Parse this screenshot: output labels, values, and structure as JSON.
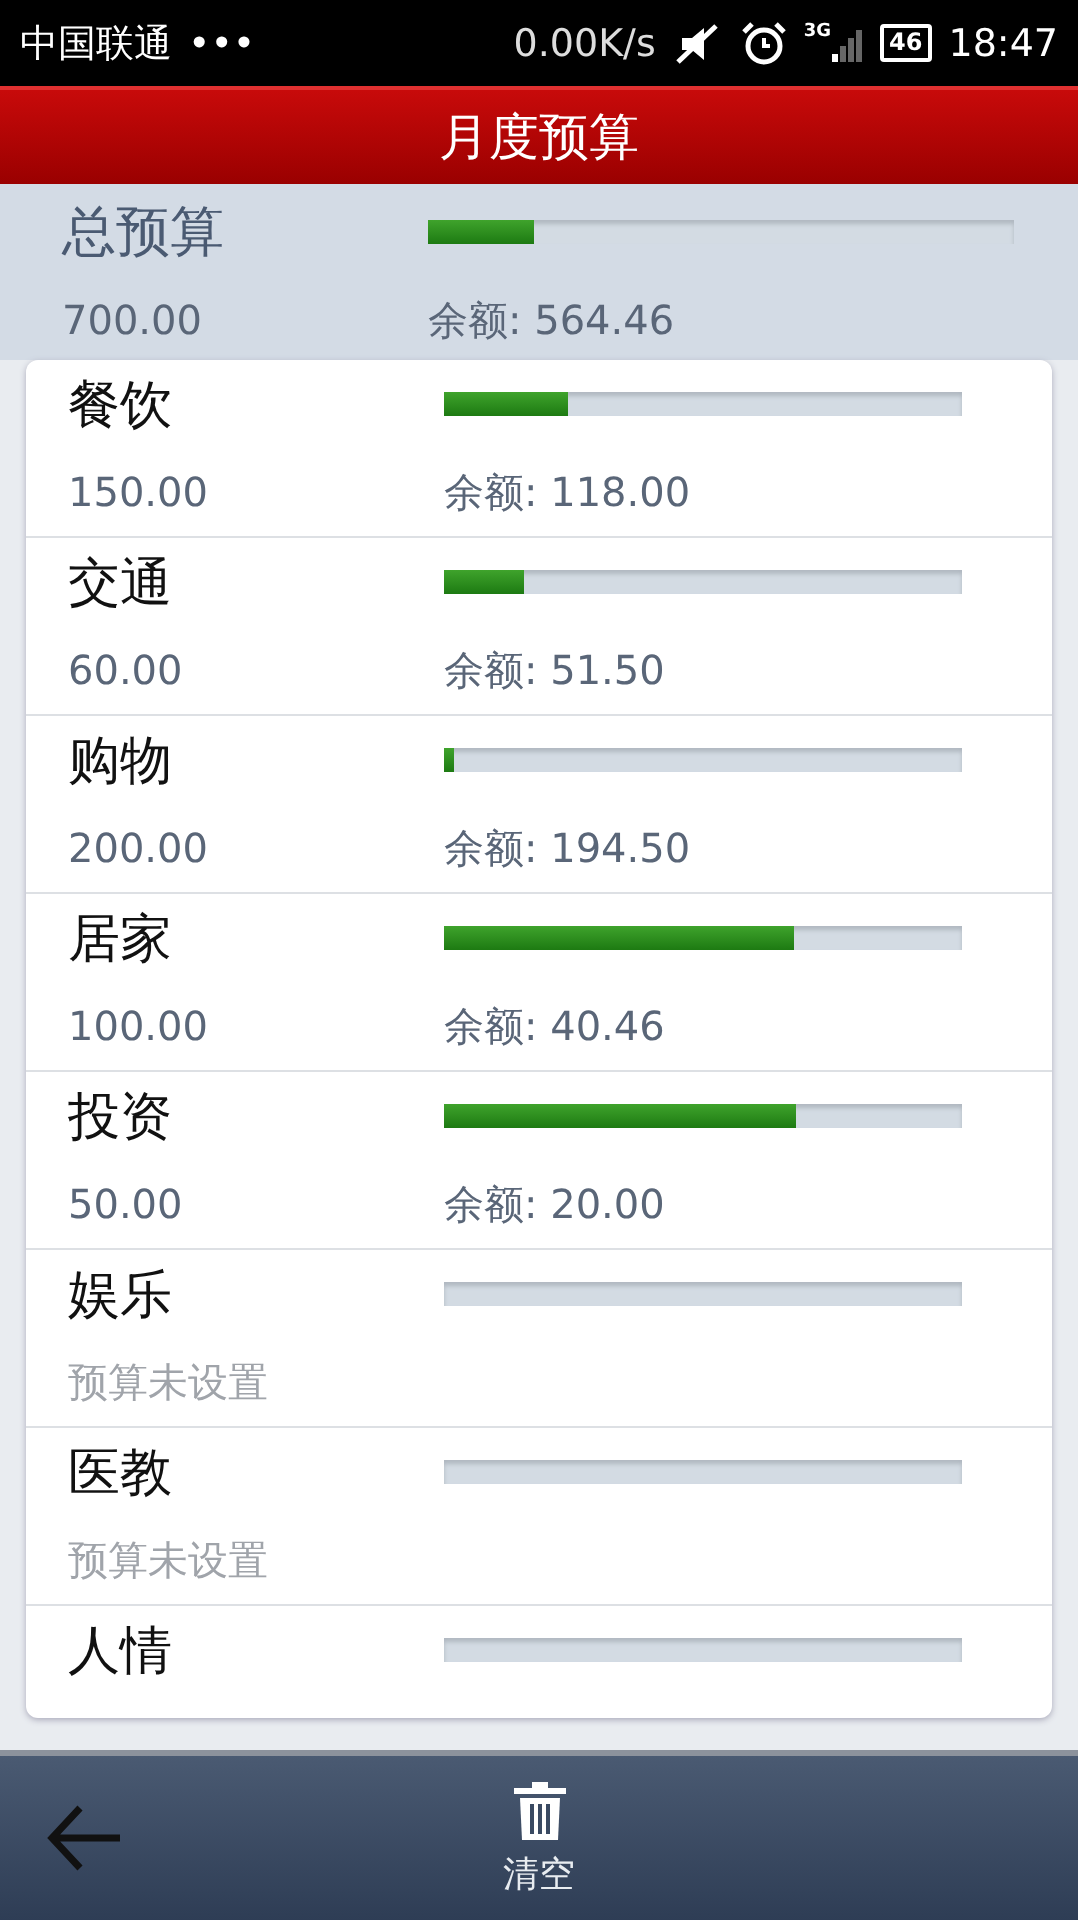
{
  "status_bar": {
    "carrier": "中国联通",
    "dots": "•••",
    "speed": "0.00K/s",
    "network": "3G",
    "battery": "46",
    "time": "18:47"
  },
  "header": {
    "title": "月度预算"
  },
  "total": {
    "name": "总预算",
    "amount": "700.00",
    "remaining": "余额: 564.46",
    "level": 0.18
  },
  "categories": [
    {
      "name": "餐饮",
      "amount": "150.00",
      "remaining": "余额: 118.00",
      "level": 0.24
    },
    {
      "name": "交通",
      "amount": "60.00",
      "remaining": "余额: 51.50",
      "level": 0.155
    },
    {
      "name": "购物",
      "amount": "200.00",
      "remaining": "余额: 194.50",
      "level": 0.02
    },
    {
      "name": "居家",
      "amount": "100.00",
      "remaining": "余额: 40.46",
      "level": 0.675
    },
    {
      "name": "投资",
      "amount": "50.00",
      "remaining": "余额: 20.00",
      "level": 0.68
    },
    {
      "name": "娱乐",
      "amount": "预算未设置"
    },
    {
      "name": "医教",
      "amount": "预算未设置"
    },
    {
      "name": "人情"
    }
  ],
  "toolbar": {
    "clear_label": "清空"
  }
}
